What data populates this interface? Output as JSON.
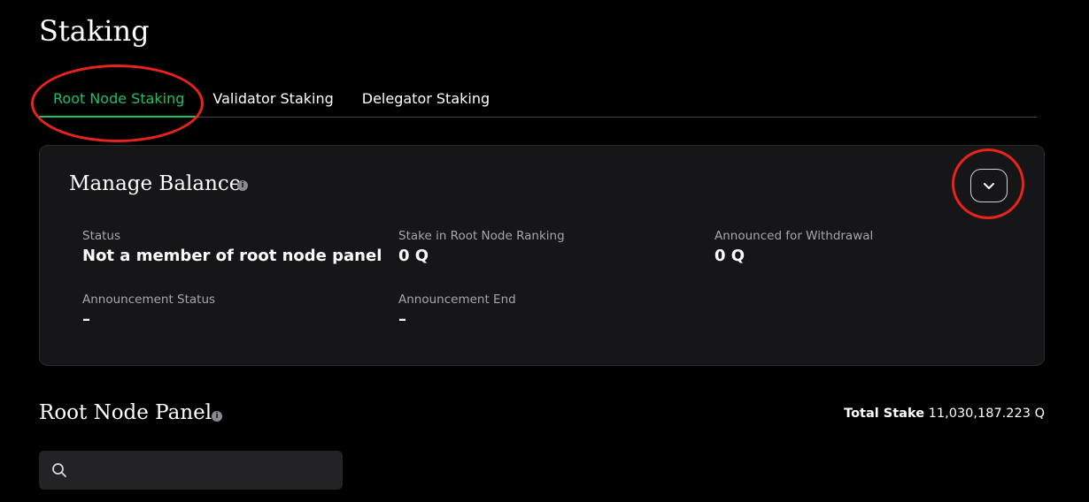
{
  "page": {
    "title": "Staking"
  },
  "tabs": [
    {
      "label": "Root Node Staking",
      "active": true
    },
    {
      "label": "Validator Staking",
      "active": false
    },
    {
      "label": "Delegator Staking",
      "active": false
    }
  ],
  "manage_balance": {
    "title": "Manage Balance",
    "info_icon": "info-icon",
    "toggle_icon": "chevron-down-icon",
    "fields": {
      "status": {
        "label": "Status",
        "value": "Not a member of root node panel"
      },
      "stake_ranking": {
        "label": "Stake in Root Node Ranking",
        "value": "0 Q"
      },
      "withdrawal": {
        "label": "Announced for Withdrawal",
        "value": "0 Q"
      },
      "announcement_status": {
        "label": "Announcement Status",
        "value": "–"
      },
      "announcement_end": {
        "label": "Announcement End",
        "value": "–"
      }
    }
  },
  "root_node_panel": {
    "title": "Root Node Panel",
    "total_stake_label": "Total Stake",
    "total_stake_value": "11,030,187.223 Q",
    "search": {
      "placeholder": "",
      "value": "",
      "icon": "search-icon"
    }
  },
  "colors": {
    "accent_green": "#1fbf63",
    "annotation_red": "#e8231a",
    "card_bg": "#161618",
    "page_bg": "#000000"
  }
}
